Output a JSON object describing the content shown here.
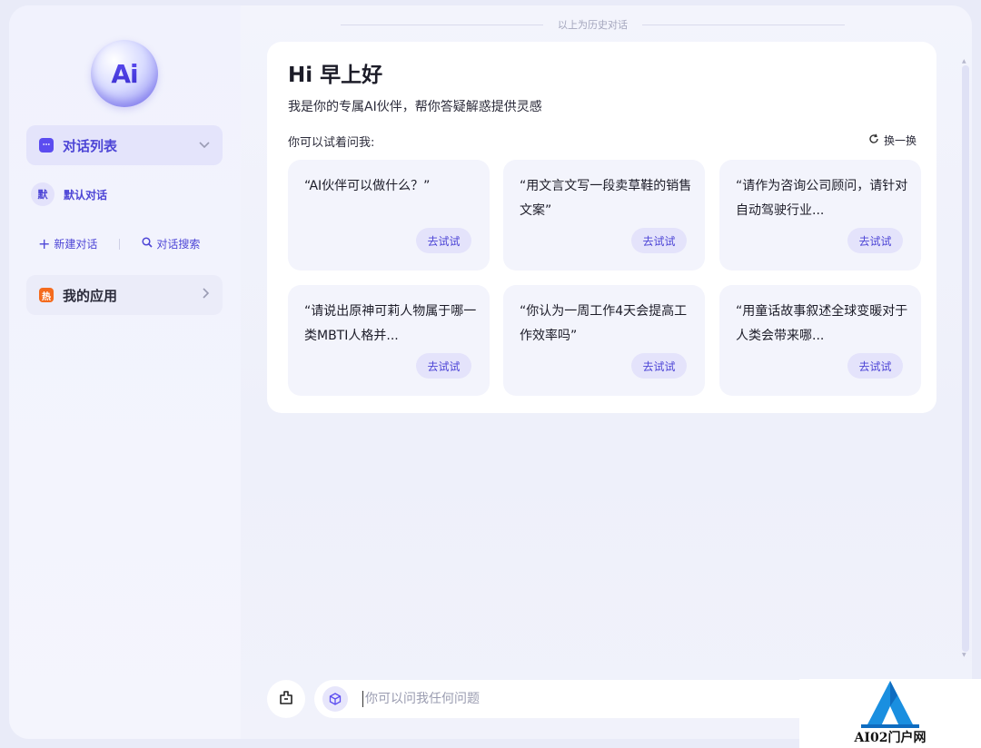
{
  "history_divider": "以上为历史对话",
  "sidebar": {
    "logo_text": "Ai",
    "conversation_list_label": "对话列表",
    "default_conversation": {
      "avatar": "默",
      "name": "默认对话"
    },
    "new_chat_label": "新建对话",
    "search_chat_label": "对话搜索",
    "my_apps": {
      "badge": "热",
      "label": "我的应用"
    }
  },
  "welcome": {
    "greeting": "Hi 早上好",
    "intro": "我是你的专属AI伙伴，帮你答疑解惑提供灵感",
    "try_label": "你可以试着问我:",
    "refresh_label": "换一换",
    "prompts": [
      {
        "text": "“AI伙伴可以做什么？”",
        "action": "去试试"
      },
      {
        "text": "“用文言文写一段卖草鞋的销售文案”",
        "action": "去试试"
      },
      {
        "text": "“请作为咨询公司顾问，请针对自动驾驶行业...",
        "action": "去试试"
      },
      {
        "text": "“请说出原神可莉人物属于哪一类MBTI人格并...",
        "action": "去试试"
      },
      {
        "text": "“你认为一周工作4天会提高工作效率吗”",
        "action": "去试试"
      },
      {
        "text": "“用童话故事叙述全球变暖对于人类会带来哪...",
        "action": "去试试"
      }
    ]
  },
  "input": {
    "placeholder": "你可以问我任何问题"
  },
  "site_badge": "AI02门户网",
  "colors": {
    "accent": "#4d45d6",
    "hot": "#f46b1e"
  }
}
